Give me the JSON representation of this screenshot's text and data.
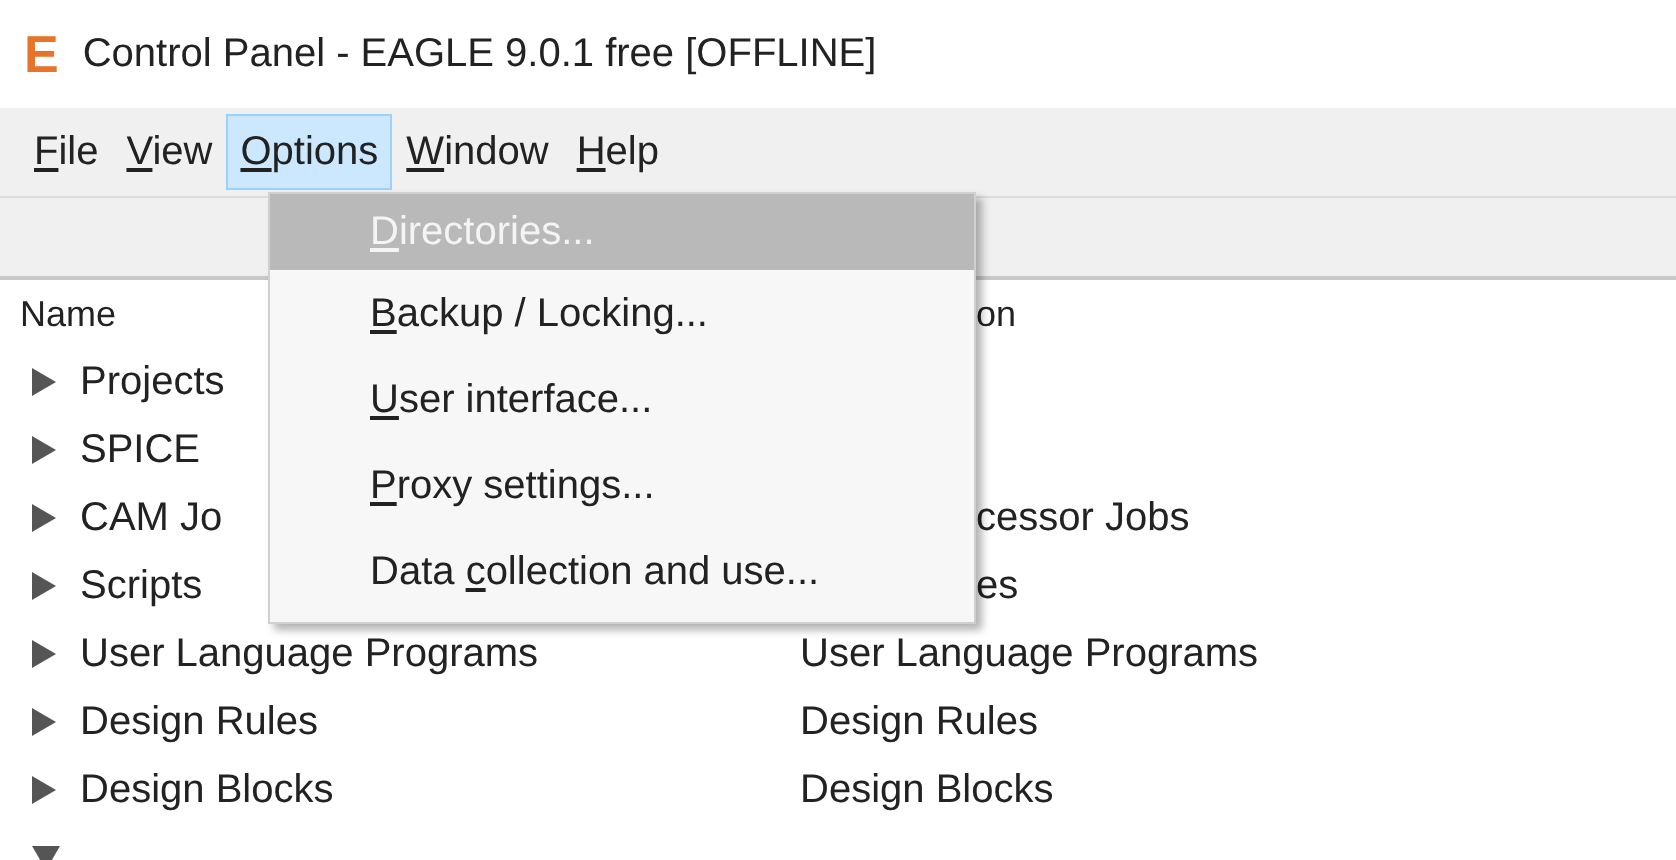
{
  "window": {
    "logo": "E",
    "title": "Control Panel - EAGLE 9.0.1 free [OFFLINE]"
  },
  "menu_bar": [
    {
      "label": {
        "key": "F",
        "after": "ile"
      },
      "selected": false
    },
    {
      "label": {
        "key": "V",
        "after": "iew"
      },
      "selected": false
    },
    {
      "label": {
        "key": "O",
        "after": "ptions"
      },
      "selected": true
    },
    {
      "label": {
        "key": "W",
        "after": "indow"
      },
      "selected": false
    },
    {
      "label": {
        "key": "H",
        "after": "elp"
      },
      "selected": false
    }
  ],
  "options_menu": [
    {
      "label": {
        "key": "D",
        "after": "irectories..."
      },
      "selected": true
    },
    {
      "label": {
        "key": "B",
        "after": "ackup / Locking..."
      },
      "selected": false
    },
    {
      "label": {
        "key": "U",
        "after": "ser interface..."
      },
      "selected": false
    },
    {
      "label": {
        "key": "P",
        "after": "roxy settings..."
      },
      "selected": false
    },
    {
      "label": {
        "before": "Data ",
        "key": "c",
        "after": "ollection and use..."
      },
      "selected": false
    }
  ],
  "tree": {
    "columns": [
      {
        "label": "Name"
      },
      {
        "label": "on",
        "covered": true
      }
    ],
    "rows": [
      {
        "name": "Projects",
        "expanded": false
      },
      {
        "name": "SPICE",
        "expanded": false
      },
      {
        "name": "CAM Jo",
        "expanded": false,
        "description": {
          "text": "cessor Jobs",
          "covered": true
        }
      },
      {
        "name": "Scripts",
        "expanded": false,
        "description": {
          "text": "es",
          "covered": true
        }
      },
      {
        "name": "User Language Programs",
        "expanded": false,
        "description": {
          "text": "User Language Programs",
          "covered": false
        }
      },
      {
        "name": "Design Rules",
        "expanded": false,
        "description": {
          "text": "Design Rules",
          "covered": false
        }
      },
      {
        "name": "Design Blocks",
        "expanded": false,
        "description": {
          "text": "Design Blocks",
          "covered": false
        }
      },
      {
        "expanded": true
      }
    ]
  }
}
